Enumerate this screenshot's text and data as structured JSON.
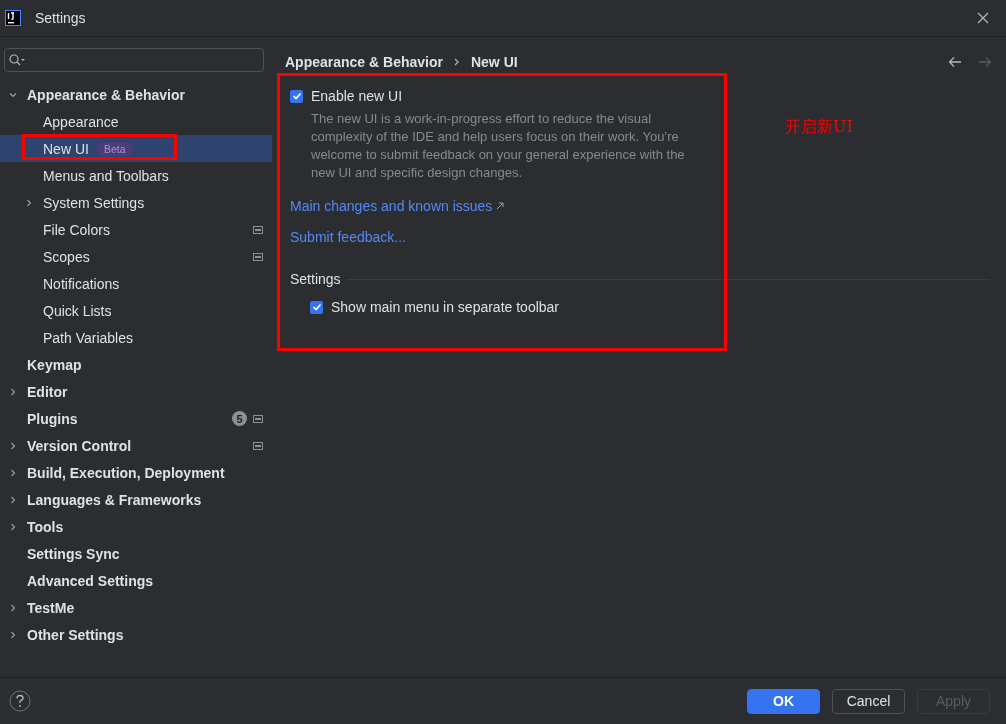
{
  "window": {
    "title": "Settings"
  },
  "tree": [
    {
      "label": "Appearance & Behavior",
      "kind": "expandable",
      "expanded": true,
      "selected": false,
      "marked": false,
      "project_scope": false,
      "children": [
        {
          "label": "Appearance",
          "kind": "leaf",
          "selected": false,
          "marked": false,
          "project_scope": false
        },
        {
          "label": "New UI",
          "kind": "leaf",
          "selected": true,
          "marked": true,
          "project_scope": false,
          "tag": "Beta"
        },
        {
          "label": "Menus and Toolbars",
          "kind": "leaf",
          "selected": false,
          "marked": false,
          "project_scope": false
        },
        {
          "label": "System Settings",
          "kind": "expandable",
          "expanded": false,
          "selected": false,
          "marked": false,
          "project_scope": false
        },
        {
          "label": "File Colors",
          "kind": "leaf",
          "selected": false,
          "marked": false,
          "project_scope": true
        },
        {
          "label": "Scopes",
          "kind": "leaf",
          "selected": false,
          "marked": false,
          "project_scope": true
        },
        {
          "label": "Notifications",
          "kind": "leaf",
          "selected": false,
          "marked": false,
          "project_scope": false
        },
        {
          "label": "Quick Lists",
          "kind": "leaf",
          "selected": false,
          "marked": false,
          "project_scope": false
        },
        {
          "label": "Path Variables",
          "kind": "leaf",
          "selected": false,
          "marked": false,
          "project_scope": false
        }
      ]
    },
    {
      "label": "Keymap",
      "kind": "leaf",
      "selected": false,
      "marked": false,
      "project_scope": false
    },
    {
      "label": "Editor",
      "kind": "expandable",
      "expanded": false,
      "selected": false,
      "marked": false,
      "project_scope": false
    },
    {
      "label": "Plugins",
      "kind": "leaf",
      "selected": false,
      "marked": false,
      "project_scope": true,
      "badge": "5"
    },
    {
      "label": "Version Control",
      "kind": "expandable",
      "expanded": false,
      "selected": false,
      "marked": false,
      "project_scope": true
    },
    {
      "label": "Build, Execution, Deployment",
      "kind": "expandable",
      "expanded": false,
      "selected": false,
      "marked": false,
      "project_scope": false
    },
    {
      "label": "Languages & Frameworks",
      "kind": "expandable",
      "expanded": false,
      "selected": false,
      "marked": false,
      "project_scope": false
    },
    {
      "label": "Tools",
      "kind": "expandable",
      "expanded": false,
      "selected": false,
      "marked": false,
      "project_scope": false
    },
    {
      "label": "Settings Sync",
      "kind": "leaf",
      "selected": false,
      "marked": false,
      "project_scope": false
    },
    {
      "label": "Advanced Settings",
      "kind": "leaf",
      "selected": false,
      "marked": false,
      "project_scope": false
    },
    {
      "label": "TestMe",
      "kind": "expandable",
      "expanded": false,
      "selected": false,
      "marked": false,
      "project_scope": false
    },
    {
      "label": "Other Settings",
      "kind": "expandable",
      "expanded": false,
      "selected": false,
      "marked": false,
      "project_scope": false
    }
  ],
  "breadcrumb": [
    "Appearance & Behavior",
    "New UI"
  ],
  "panel": {
    "marked": true,
    "enable": {
      "label": "Enable new UI",
      "checked": true
    },
    "description": "The new UI is a work-in-progress effort to reduce the visual complexity of the IDE and help users focus on their work. You’re welcome to submit feedback on your general experience with the new UI and specific design changes.",
    "links": [
      {
        "label": "Main changes and known issues",
        "external": true
      },
      {
        "label": "Submit feedback...",
        "external": false
      }
    ],
    "section": "Settings",
    "options": [
      {
        "label": "Show main menu in separate toolbar",
        "checked": true
      }
    ]
  },
  "annotation_note": "开启新UI",
  "buttons": [
    {
      "label": "OK",
      "kind": "primary",
      "disabled": false
    },
    {
      "label": "Cancel",
      "kind": "normal",
      "disabled": false
    },
    {
      "label": "Apply",
      "kind": "normal",
      "disabled": true
    }
  ]
}
